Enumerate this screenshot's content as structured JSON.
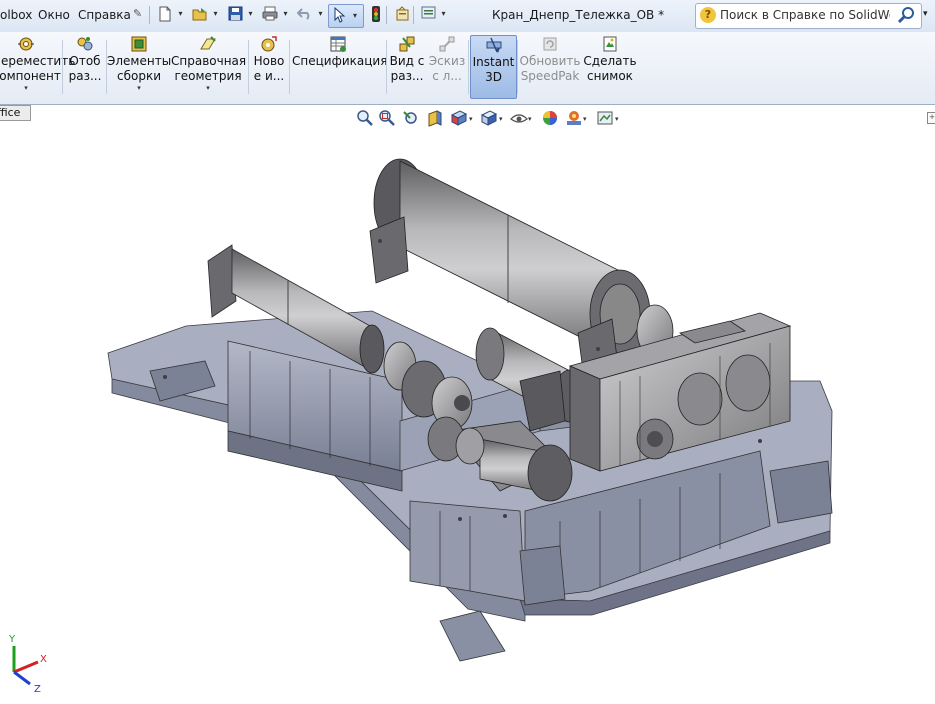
{
  "menu": {
    "toolbox_label": "olbox",
    "window_label": "Окно",
    "help_label": "Справка"
  },
  "quick_access": {
    "icons": [
      "new-document-icon",
      "open-icon",
      "save-icon",
      "print-icon",
      "undo-icon",
      "select-icon",
      "traffic-light-icon",
      "file-properties-icon",
      "options-icon"
    ]
  },
  "title": "Кран_Днепр_Тележка_ОВ *",
  "search": {
    "placeholder": "Поиск в Справке по SolidWorks"
  },
  "ribbon": {
    "items": [
      {
        "label": "Переместить\nкомпонент",
        "icon": "move-component-icon"
      },
      {
        "label": "Отоб\nраз...",
        "icon": "show-hidden-icon"
      },
      {
        "label": "Элементы\nсборки",
        "icon": "assembly-features-icon"
      },
      {
        "label": "Справочная\nгеометрия",
        "icon": "reference-geometry-icon"
      },
      {
        "label": "Ново\nе и...",
        "icon": "new-motion-study-icon"
      },
      {
        "label": "Спецификация",
        "icon": "bill-of-materials-icon"
      },
      {
        "label": "Вид с\nраз...",
        "icon": "exploded-view-icon"
      },
      {
        "label": "Эскиз\nс л...",
        "icon": "explode-line-sketch-icon"
      },
      {
        "label": "Instant\n3D",
        "icon": "instant-3d-icon"
      },
      {
        "label": "Обновить\nSpeedPak",
        "icon": "update-speedpak-icon"
      },
      {
        "label": "Сделать\nснимок",
        "icon": "take-snapshot-icon"
      }
    ]
  },
  "tab": {
    "label": "ffice"
  },
  "view_toolbar": {
    "icons": [
      "zoom-to-fit-icon",
      "zoom-to-area-icon",
      "previous-view-icon",
      "section-view-icon",
      "view-orientation-icon",
      "display-style-icon",
      "hide-show-items-icon",
      "edit-appearance-icon",
      "apply-scene-icon",
      "view-settings-icon"
    ]
  },
  "triad": {
    "x": "X",
    "y": "Y",
    "z": "Z"
  },
  "colors": {
    "ui_bar": "#dbe6f4",
    "highlight": "#9dbbe6",
    "model_base": "#8c93a6",
    "model_metal": "#a8a8aa",
    "axis_x": "#d42020",
    "axis_y": "#1aa01a",
    "axis_z": "#2040d0"
  }
}
